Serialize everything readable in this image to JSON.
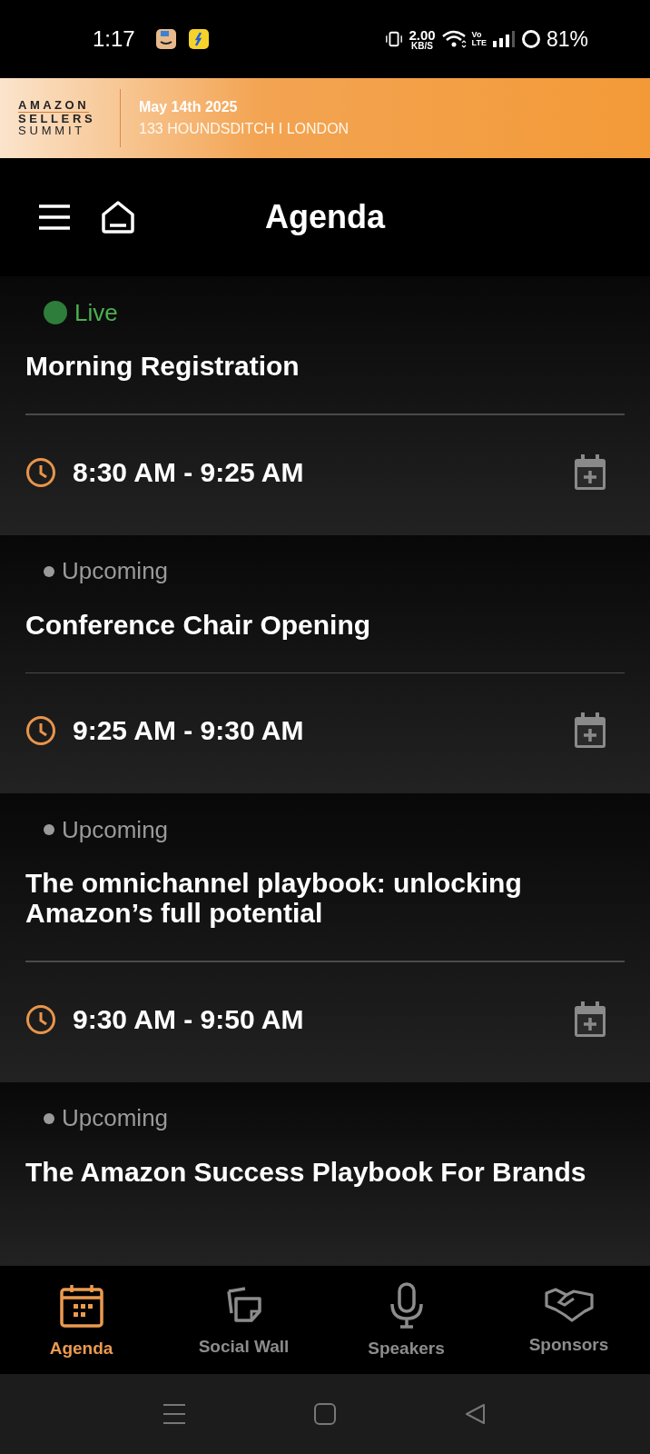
{
  "status_bar": {
    "time": "1:17",
    "speed_value": "2.00",
    "speed_unit": "KB/S",
    "volte_top": "Vo",
    "volte_bottom": "LTE",
    "battery": "81%"
  },
  "banner": {
    "logo_line_1": "AMAZON",
    "logo_line_2": "SELLERS",
    "logo_line_3": "SUMMIT",
    "date": "May 14th 2025",
    "venue": "133 HOUNDSDITCH I LONDON"
  },
  "header": {
    "title": "Agenda"
  },
  "sessions": [
    {
      "status": {
        "kind": "live",
        "label": "Live"
      },
      "title": "Morning Registration",
      "time": "8:30 AM - 9:25 AM"
    },
    {
      "status": {
        "kind": "upcoming",
        "label": "Upcoming"
      },
      "title": "Conference Chair Opening",
      "time": "9:25 AM - 9:30 AM"
    },
    {
      "status": {
        "kind": "upcoming",
        "label": "Upcoming"
      },
      "title": "The omnichannel playbook: unlocking Amazon’s full potential",
      "time": "9:30 AM - 9:50 AM"
    },
    {
      "status": {
        "kind": "upcoming",
        "label": "Upcoming"
      },
      "title": "The Amazon Success Playbook For Brands"
    }
  ],
  "bottom_nav": [
    {
      "kind": "agenda",
      "label": "Agenda",
      "selected": true
    },
    {
      "kind": "social",
      "label": "Social Wall",
      "selected": false
    },
    {
      "kind": "speakers",
      "label": "Speakers",
      "selected": false
    },
    {
      "kind": "sponsors",
      "label": "Sponsors",
      "selected": false
    }
  ]
}
